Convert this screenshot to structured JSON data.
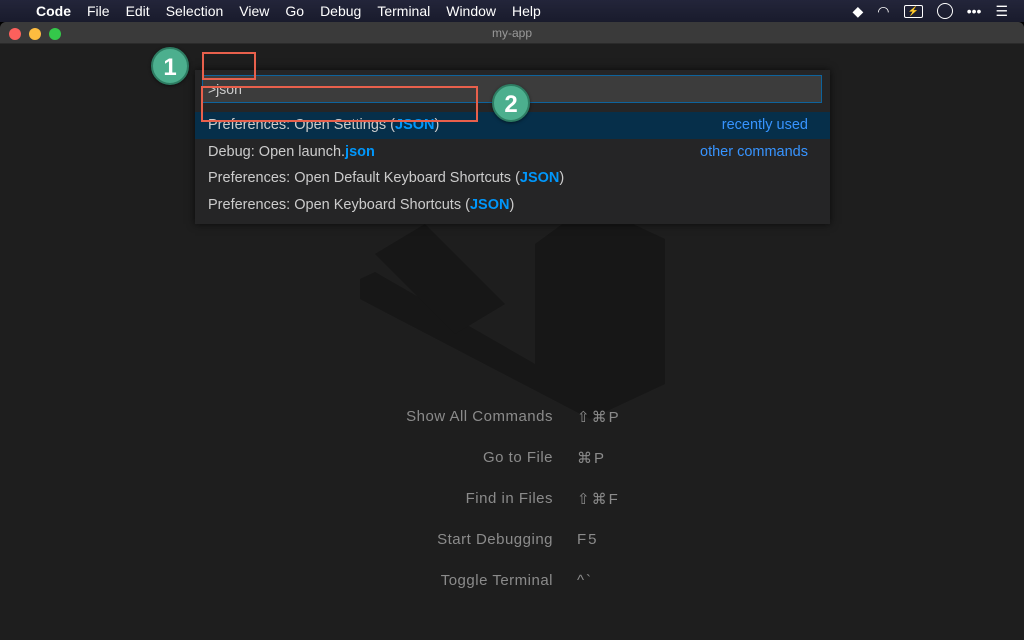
{
  "menubar": {
    "app": "Code",
    "items": [
      "File",
      "Edit",
      "Selection",
      "View",
      "Go",
      "Debug",
      "Terminal",
      "Window",
      "Help"
    ],
    "tray_icons": [
      "dropbox-icon",
      "wifi-icon",
      "battery-charging-icon",
      "clock-icon",
      "more-icon",
      "list-icon"
    ]
  },
  "window": {
    "title": "my-app"
  },
  "quick_open": {
    "input_value": ">json",
    "items": [
      {
        "prefix": "Preferences: Open Settings (",
        "match": "JSON",
        "suffix": ")",
        "category": "recently used",
        "selected": true
      },
      {
        "prefix": "Debug: Open launch.",
        "match": "json",
        "suffix": "",
        "category": "other commands"
      },
      {
        "prefix": "Preferences: Open Default Keyboard Shortcuts (",
        "match": "JSON",
        "suffix": ")",
        "category": ""
      },
      {
        "prefix": "Preferences: Open Keyboard Shortcuts (",
        "match": "JSON",
        "suffix": ")",
        "category": ""
      }
    ]
  },
  "annotations": {
    "step1": "1",
    "step2": "2"
  },
  "shortcuts": [
    {
      "label": "Show All Commands",
      "keys": "⇧⌘P"
    },
    {
      "label": "Go to File",
      "keys": "⌘P"
    },
    {
      "label": "Find in Files",
      "keys": "⇧⌘F"
    },
    {
      "label": "Start Debugging",
      "keys": "F5"
    },
    {
      "label": "Toggle Terminal",
      "keys": "^`"
    }
  ],
  "colors": {
    "accent": "#0097fb",
    "selection": "#062f4a",
    "annotation": "#4caf8e",
    "highlight_box": "#e8604c"
  }
}
